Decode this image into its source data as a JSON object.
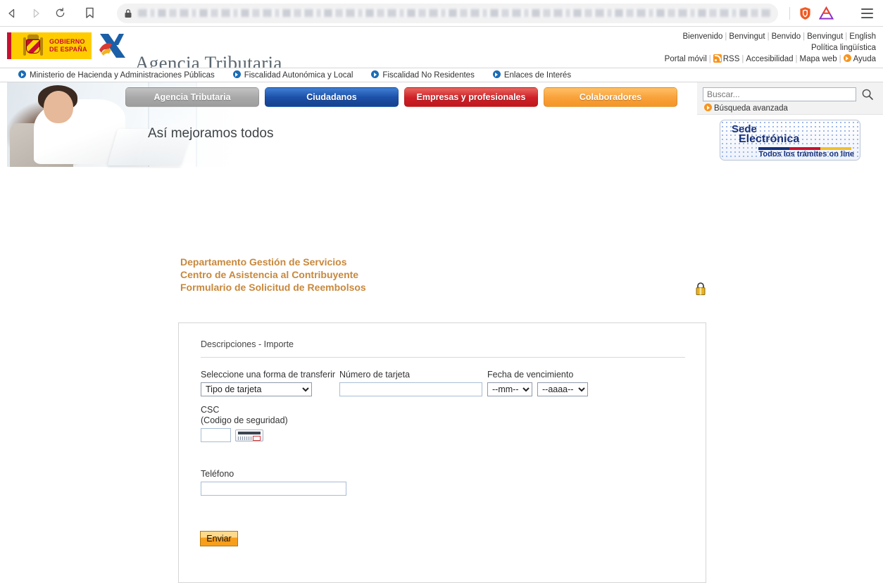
{
  "browser": {
    "back_title": "Back",
    "forward_title": "Forward",
    "reload_title": "Reload",
    "bookmark_title": "Bookmark",
    "url_value": "",
    "url_redacted": true,
    "brave_shield_title": "Brave Shields",
    "extension_title": "Extension",
    "menu_title": "Menu"
  },
  "header": {
    "gov_logo_line1": "GOBIERNO",
    "gov_logo_line2": "DE ESPAÑA",
    "agency_name": "Agencia Tributaria",
    "lang_links": [
      "Bienvenido",
      "Benvingut",
      "Benvido",
      "Benvingut",
      "English"
    ],
    "policy_link": "Política lingüística",
    "util_links": [
      "Portal móvil",
      "RSS",
      "Accesibilidad",
      "Mapa web",
      "Ayuda"
    ]
  },
  "subnav": {
    "items": [
      "Ministerio de Hacienda y Administraciones Públicas",
      "Fiscalidad Autonómica y Local",
      "Fiscalidad No Residentes",
      "Enlaces de Interés"
    ]
  },
  "hero": {
    "tagline": "Así mejoramos todos",
    "tabs": [
      {
        "label": "Agencia Tributaria",
        "color": "#a8a8a8",
        "style": "gray"
      },
      {
        "label": "Ciudadanos",
        "color": "#1c50a8",
        "style": "blue"
      },
      {
        "label": "Empresas y profesionales",
        "color": "#cf2128",
        "style": "red"
      },
      {
        "label": "Colaboradores",
        "color": "#f9a23a",
        "style": "orange"
      }
    ]
  },
  "search": {
    "placeholder": "Buscar...",
    "value": "",
    "advanced_label": "Búsqueda avanzada",
    "button_icon": "search-icon"
  },
  "sede": {
    "line1": "Sede",
    "line2": "Electrónica",
    "line3": "Todos los trámites on line",
    "color": "#17317a"
  },
  "form": {
    "heading_line1": "Departamento Gestión de Servicios",
    "heading_line2": "Centro de Asistencia al Contribuyente",
    "heading_line3": "Formulario de Solicitud de Reembolsos",
    "heading_color": "#c8883c",
    "lock_icon": "padlock-icon",
    "panel_title": "Descripciones - Importe",
    "fields": {
      "transfer_label": "Seleccione una forma de transferir",
      "transfer_value": "Tipo de tarjeta",
      "card_number_label": "Número de tarjeta",
      "card_number_value": "",
      "expiry_label": "Fecha de vencimiento",
      "expiry_month_value": "--mm--",
      "expiry_year_value": "--aaaa--",
      "csc_label": "CSC",
      "csc_sublabel": "(Codigo de seguridad)",
      "csc_value": "",
      "csc_hint_icon": "credit-card-cvv-icon",
      "phone_label": "Teléfono",
      "phone_value": ""
    },
    "submit_label": "Enviar"
  }
}
